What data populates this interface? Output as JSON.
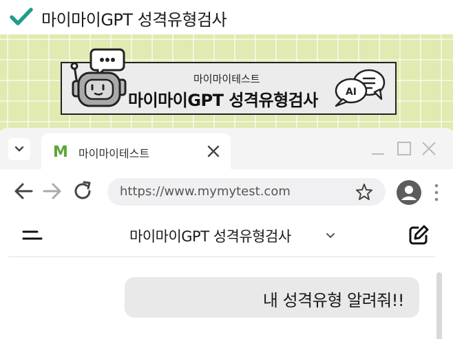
{
  "header": {
    "title": "마이마이GPT 성격유형검사",
    "check_color": "#1f9e8a"
  },
  "banner": {
    "subtitle": "마이마이테스트",
    "title": "마이마이GPT 성격유형검사",
    "ai_label": "AI",
    "background_color": "#e0eab1"
  },
  "browser": {
    "tab": {
      "title": "마이마이테스트",
      "favicon_letter": "M",
      "favicon_color": "#5aa63a"
    },
    "address_bar": {
      "url": "https://www.mymytest.com"
    },
    "page": {
      "title": "마이마이GPT 성격유형검사",
      "user_message": "내 성격유형 알려줘!!"
    }
  },
  "icons": [
    "check-icon",
    "robot-icon",
    "chat-bubbles-icon",
    "tab-dropdown-icon",
    "close-icon",
    "minimize-icon",
    "maximize-icon",
    "window-close-icon",
    "back-icon",
    "forward-icon",
    "reload-icon",
    "star-icon",
    "avatar-icon",
    "kebab-icon",
    "menu-icon",
    "chevron-down-icon",
    "edit-icon"
  ]
}
